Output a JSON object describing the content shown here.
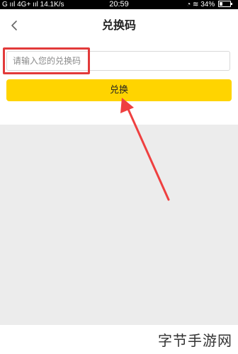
{
  "status_bar": {
    "left": "G ııl 4G+ ııl 14.1K/s",
    "time": "20:59",
    "right": "34%"
  },
  "header": {
    "title": "兑换码",
    "back_icon": "chevron-left-icon"
  },
  "redeem": {
    "placeholder": "请输入您的兑换码",
    "button_label": "兑换"
  },
  "watermark": "字节手游网",
  "colors": {
    "button": "#ffd400",
    "highlight": "#e23a3a",
    "background": "#ececec"
  }
}
